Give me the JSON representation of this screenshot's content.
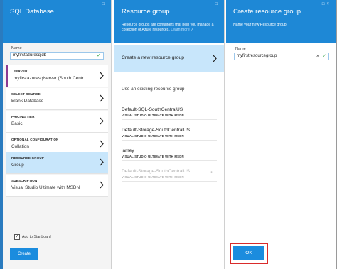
{
  "window_controls": {
    "minimize": "_",
    "maximize": "□",
    "close": "×"
  },
  "sql_blade": {
    "title": "SQL Database",
    "name_label": "Name",
    "name_value": "myfirstazuresqldb",
    "sections": [
      {
        "title": "SERVER",
        "value": "myfirstazuresqlserver (South Centr..."
      },
      {
        "title": "SELECT SOURCE",
        "value": "Blank Database"
      },
      {
        "title": "PRICING TIER",
        "value": "Basic"
      },
      {
        "title": "OPTIONAL CONFIGURATION",
        "value": "Collation"
      },
      {
        "title": "RESOURCE GROUP",
        "value": "Group"
      },
      {
        "title": "SUBSCRIPTION",
        "value": "Visual Studio Ultimate with MSDN"
      }
    ],
    "add_to_startboard_label": "Add to Startboard",
    "add_to_startboard_checked": true,
    "create_label": "Create"
  },
  "rg_blade": {
    "title": "Resource group",
    "description": "Resource groups are containers that help you manage a collection of Azure resources.",
    "learn_more": "Learn more",
    "create_new_label": "Create a new resource group",
    "use_existing_label": "Use an existing resource group",
    "groups": [
      {
        "name": "Default-SQL-SouthCentralUS",
        "subscription": "VISUAL STUDIO ULTIMATE WITH MSDN",
        "enabled": true
      },
      {
        "name": "Default-Storage-SouthCentralUS",
        "subscription": "VISUAL STUDIO ULTIMATE WITH MSDN",
        "enabled": true
      },
      {
        "name": "jamey",
        "subscription": "VISUAL STUDIO ULTIMATE WITH MSDN",
        "enabled": true
      },
      {
        "name": "Default-Storage-SouthCentralUS",
        "subscription": "VISUAL STUDIO ULTIMATE WITH MSDN",
        "enabled": false
      }
    ]
  },
  "create_rg_blade": {
    "title": "Create resource group",
    "description": "Name your new Resource group.",
    "name_label": "Name",
    "name_value": "myfirstresourcegroup",
    "ok_label": "OK"
  },
  "colors": {
    "header_blue": "#1e88d6",
    "selected_row": "#c8e6fb",
    "primary_button": "#1b8cde",
    "highlight_red": "#d92b2b",
    "valid_green": "#2fa043"
  }
}
